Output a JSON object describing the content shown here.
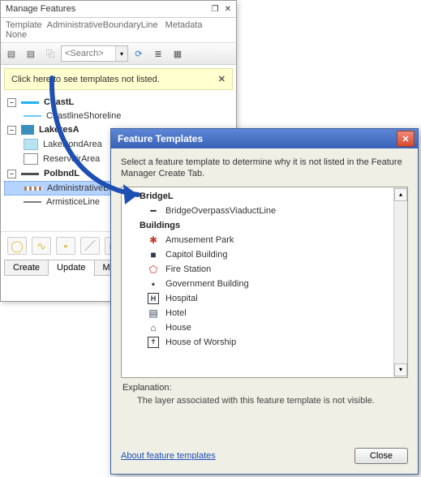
{
  "manage": {
    "title": "Manage Features",
    "subtitle_template": "Template",
    "subtitle_value": "AdministrativeBoundaryLine",
    "subtitle_meta": "Metadata",
    "subtitle_meta_val": "None",
    "search_placeholder": "<Search>",
    "banner_text": "Click here to see templates not listed.",
    "groups": [
      {
        "label": "CoastL",
        "items": [
          {
            "label": "CoastlineShoreline",
            "swatch": "shore"
          }
        ]
      },
      {
        "label": "LakeresA",
        "items": [
          {
            "label": "LakePondArea",
            "swatch": "lpa"
          },
          {
            "label": "ReservoirArea",
            "swatch": "resa"
          }
        ]
      },
      {
        "label": "PolbndL",
        "items": [
          {
            "label": "AdministrativeBoundaryLine",
            "swatch": "admin",
            "selected": true
          },
          {
            "label": "ArmisticeLine",
            "swatch": "armis"
          }
        ]
      }
    ],
    "tabs": {
      "create": "Create",
      "update": "Update",
      "metadata": "Metadata"
    }
  },
  "ft": {
    "title": "Feature Templates",
    "instruction": "Select a feature template to determine why it is not listed in the Feature Manager Create Tab.",
    "groups": [
      {
        "label": "BridgeL",
        "items": [
          {
            "label": "BridgeOverpassViaductLine",
            "icon": "line"
          }
        ]
      },
      {
        "label": "Buildings",
        "items": [
          {
            "label": "Amusement Park",
            "icon": "ferris",
            "color": "red"
          },
          {
            "label": "Capitol Building",
            "icon": "square",
            "color": "dark"
          },
          {
            "label": "Fire Station",
            "icon": "pentagon",
            "color": "red"
          },
          {
            "label": "Government Building",
            "icon": "square",
            "color": "dark"
          },
          {
            "label": "Hospital",
            "icon": "h",
            "color": "dark"
          },
          {
            "label": "Hotel",
            "icon": "stripes",
            "color": "dark"
          },
          {
            "label": "House",
            "icon": "house",
            "color": "dark"
          },
          {
            "label": "House of Worship",
            "icon": "church",
            "color": "dark"
          }
        ]
      }
    ],
    "explanation_label": "Explanation:",
    "explanation_text": "The layer associated with this feature template is not visible.",
    "link": "About feature templates",
    "close": "Close"
  }
}
